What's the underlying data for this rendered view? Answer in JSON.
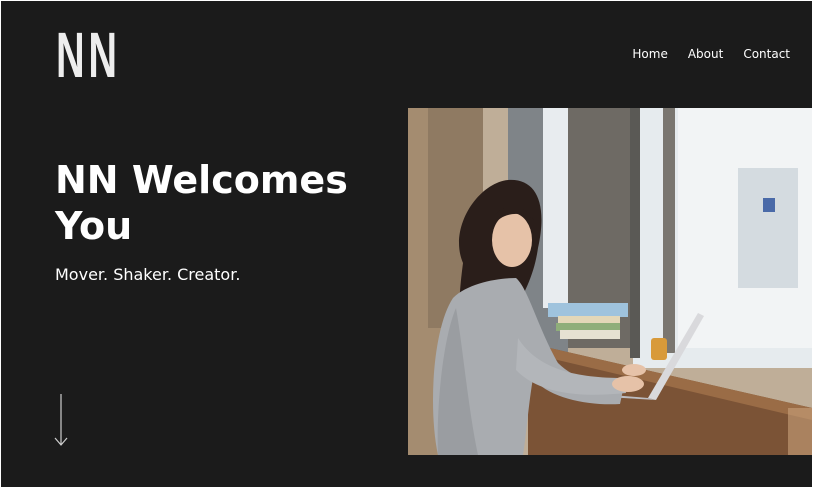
{
  "brand": {
    "logo_text": "NN"
  },
  "nav": {
    "items": [
      {
        "label": "Home"
      },
      {
        "label": "About"
      },
      {
        "label": "Contact"
      }
    ]
  },
  "hero": {
    "title": "NN Welcomes You",
    "subtitle": "Mover. Shaker. Creator.",
    "scroll_icon": "arrow-down-icon",
    "image_icon": "hero-photo"
  },
  "colors": {
    "background": "#1b1b1b",
    "text": "#ffffff",
    "logo": "#ededed"
  }
}
